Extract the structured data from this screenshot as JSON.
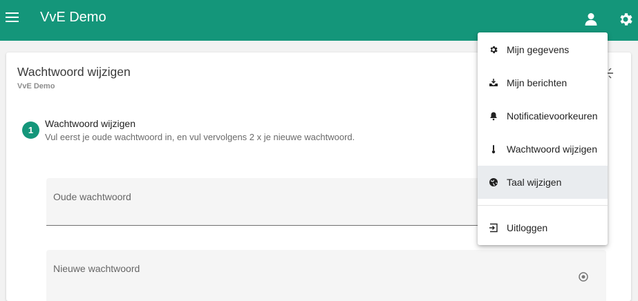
{
  "app": {
    "title": "VvE Demo"
  },
  "card": {
    "title": "Wachtwoord wijzigen",
    "subtitle": "VvE Demo"
  },
  "step": {
    "number": "1",
    "title": "Wachtwoord wijzigen",
    "description": "Vul eerst je oude wachtwoord in, en vul vervolgens 2 x je nieuwe wachtwoord."
  },
  "fields": {
    "old_password_label": "Oude wachtwoord",
    "new_password_label": "Nieuwe wachtwoord"
  },
  "user_menu": {
    "items": [
      {
        "label": "Mijn gegevens",
        "icon": "gear-icon"
      },
      {
        "label": "Mijn berichten",
        "icon": "inbox-icon"
      },
      {
        "label": "Notificatievoorkeuren",
        "icon": "bell-icon"
      },
      {
        "label": "Wachtwoord wijzigen",
        "icon": "thermometer-icon"
      },
      {
        "label": "Taal wijzigen",
        "icon": "globe-icon",
        "active": true
      },
      {
        "label": "Uitloggen",
        "icon": "logout-icon"
      }
    ]
  },
  "colors": {
    "primary": "#14967a",
    "active_item_bg": "#e9ecef"
  }
}
